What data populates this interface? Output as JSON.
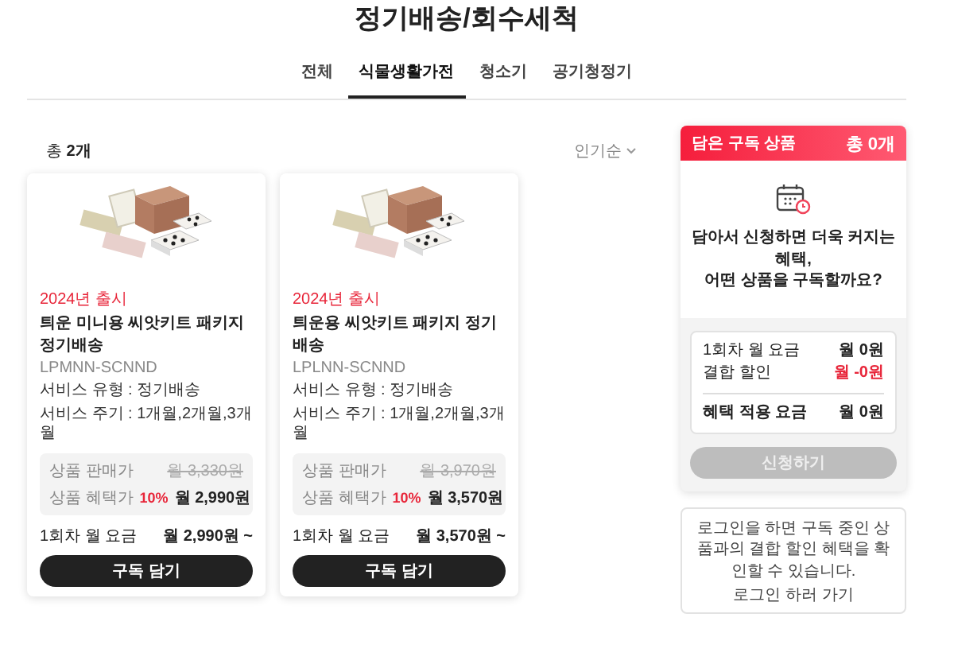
{
  "page_title": "정기배송/회수세척",
  "tabs": [
    {
      "label": "전체",
      "selected": false
    },
    {
      "label": "식물생활가전",
      "selected": true
    },
    {
      "label": "청소기",
      "selected": false
    },
    {
      "label": "공기청정기",
      "selected": false
    }
  ],
  "total_count": "총 **2개**",
  "sort": {
    "label": "인기순"
  },
  "products": [
    {
      "released": "2024년 출시",
      "name": "틔운 미니용 씨앗키트 패키지 정기배송",
      "code": "LPMNN-SCNND",
      "service_type": "서비스 유형 : 정기배송",
      "service_cycle": "서비스 주기 : 1개월,2개월,3개월",
      "sale_price_label": "상품 판매가",
      "sale_price": "월 3,330원",
      "benefit_price_label": "상품 혜택가",
      "discount": "10%",
      "benefit_price": "월 2,990원",
      "first_month_label": "1회차 월 요금",
      "first_month_price": "월 2,990원 ~",
      "button": "구독 담기"
    },
    {
      "released": "2024년 출시",
      "name": "틔운용 씨앗키트 패키지 정기배송",
      "code": "LPLNN-SCNND",
      "service_type": "서비스 유형 : 정기배송",
      "service_cycle": "서비스 주기 : 1개월,2개월,3개월",
      "sale_price_label": "상품 판매가",
      "sale_price": "월 3,970원",
      "benefit_price_label": "상품 혜택가",
      "discount": "10%",
      "benefit_price": "월 3,570원",
      "first_month_label": "1회차 월 요금",
      "first_month_price": "월 3,570원 ~",
      "button": "구독 담기"
    }
  ],
  "cart": {
    "title": "담은 구독 상품",
    "count": "총 0개",
    "message": "담아서 신청하면 더욱 커지는 혜택,\n어떤 상품을 구독할까요?",
    "summary": [
      {
        "label": "1회차 월 요금",
        "value": "월 0원",
        "kind": "normal"
      },
      {
        "label": "결합 할인",
        "value": "월 -0원",
        "kind": "discount"
      }
    ],
    "total": {
      "label": "혜택 적용 요금",
      "value": "월 0원"
    },
    "apply_button": {
      "label": "신청하기",
      "disabled": true
    }
  },
  "login": {
    "message": "로그인을 하면 구독 중인 상품과의 결합 할인 혜택을 확인할 수 있습니다.",
    "link": "로그인 하러 가기"
  }
}
